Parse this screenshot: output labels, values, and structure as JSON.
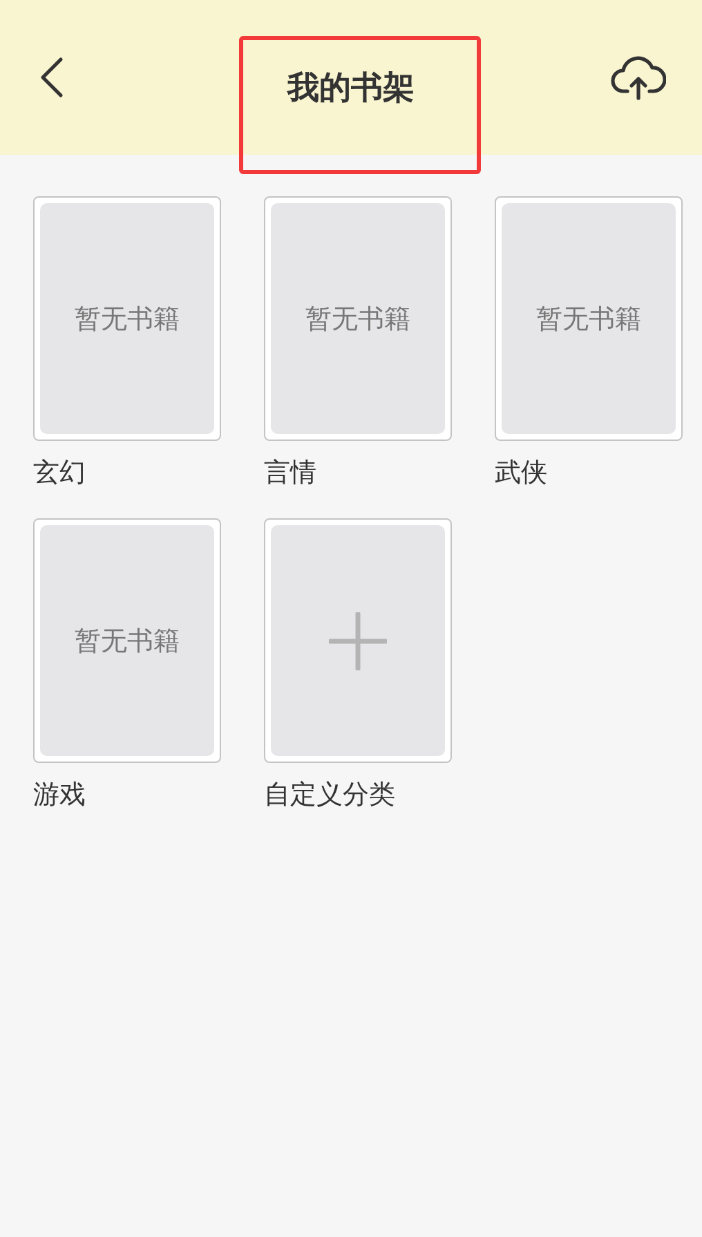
{
  "header": {
    "title": "我的书架",
    "title_highlighted": true
  },
  "shelves": [
    {
      "kind": "category",
      "label": "玄幻",
      "placeholder": "暂无书籍"
    },
    {
      "kind": "category",
      "label": "言情",
      "placeholder": "暂无书籍"
    },
    {
      "kind": "category",
      "label": "武侠",
      "placeholder": "暂无书籍"
    },
    {
      "kind": "category",
      "label": "游戏",
      "placeholder": "暂无书籍"
    },
    {
      "kind": "add",
      "label": "自定义分类"
    }
  ]
}
